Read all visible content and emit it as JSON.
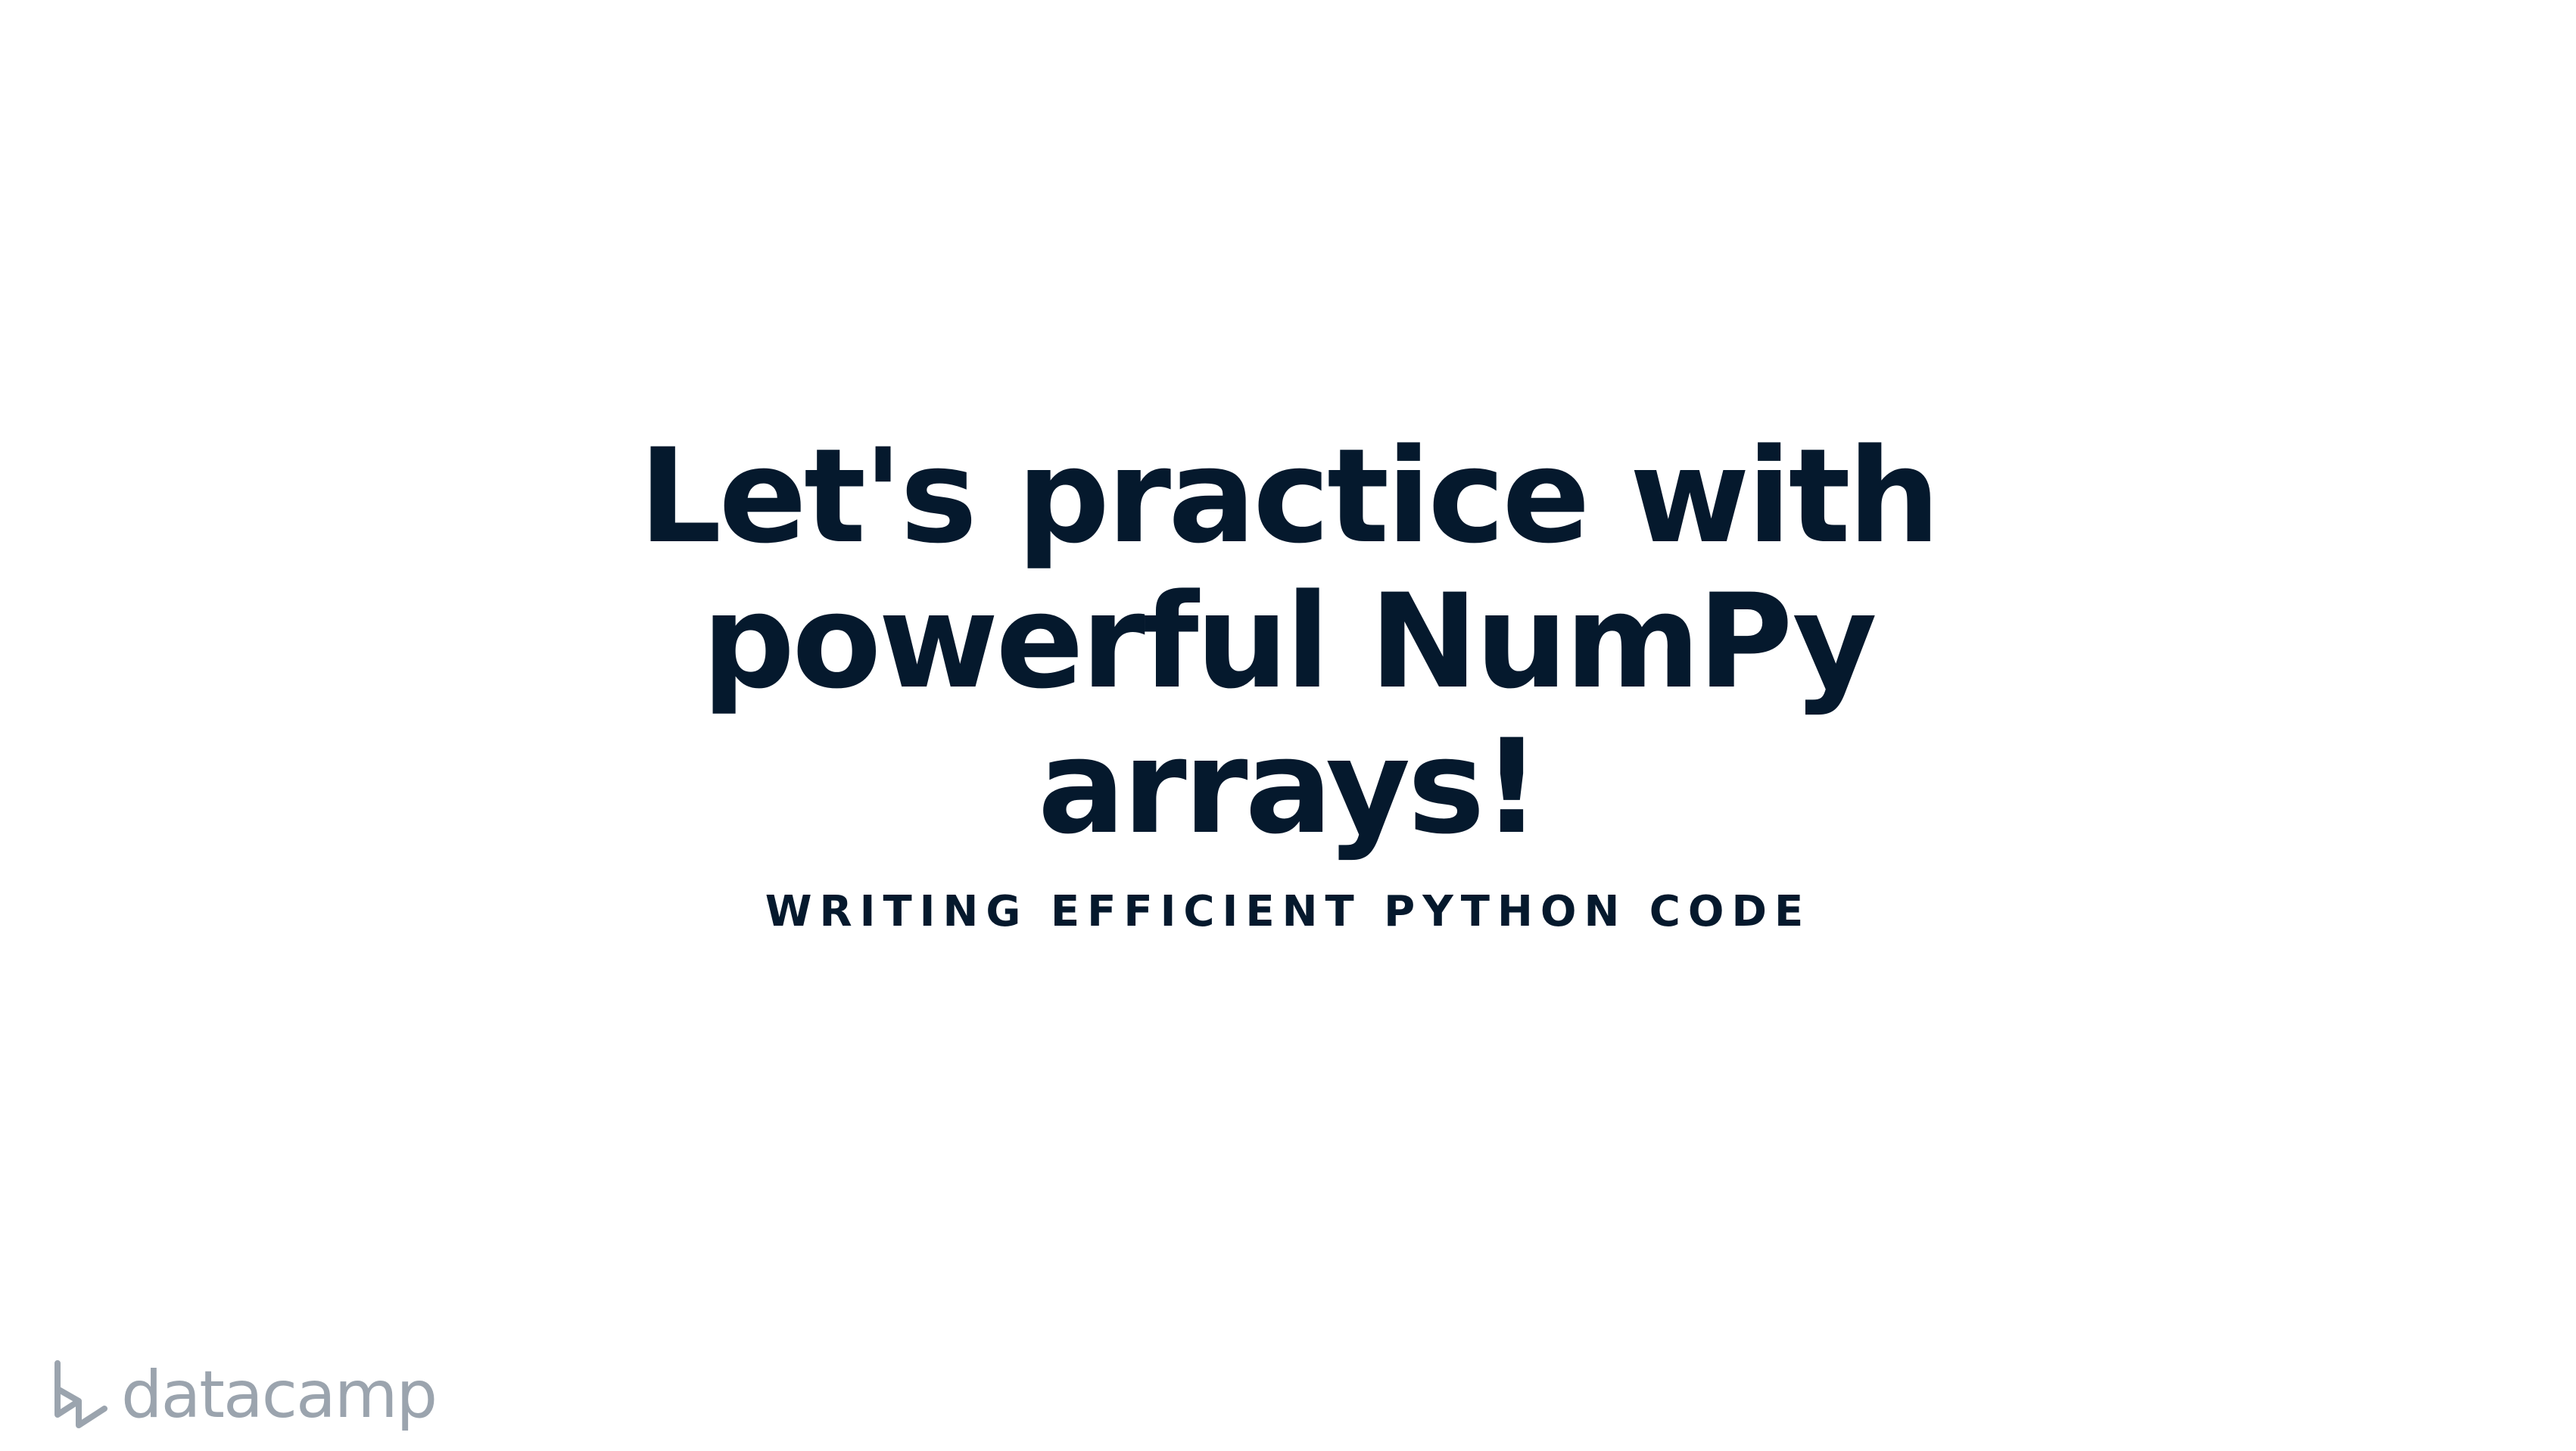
{
  "slide": {
    "title_lines": [
      "Let's practice with",
      "powerful NumPy",
      "arrays!"
    ],
    "subtitle": "WRITING EFFICIENT PYTHON CODE"
  },
  "brand": {
    "logo_icon": "datacamp-logo-icon",
    "name": "datacamp"
  },
  "colors": {
    "title": "#05192d",
    "logo": "#9ba4ae",
    "background": "#ffffff"
  }
}
